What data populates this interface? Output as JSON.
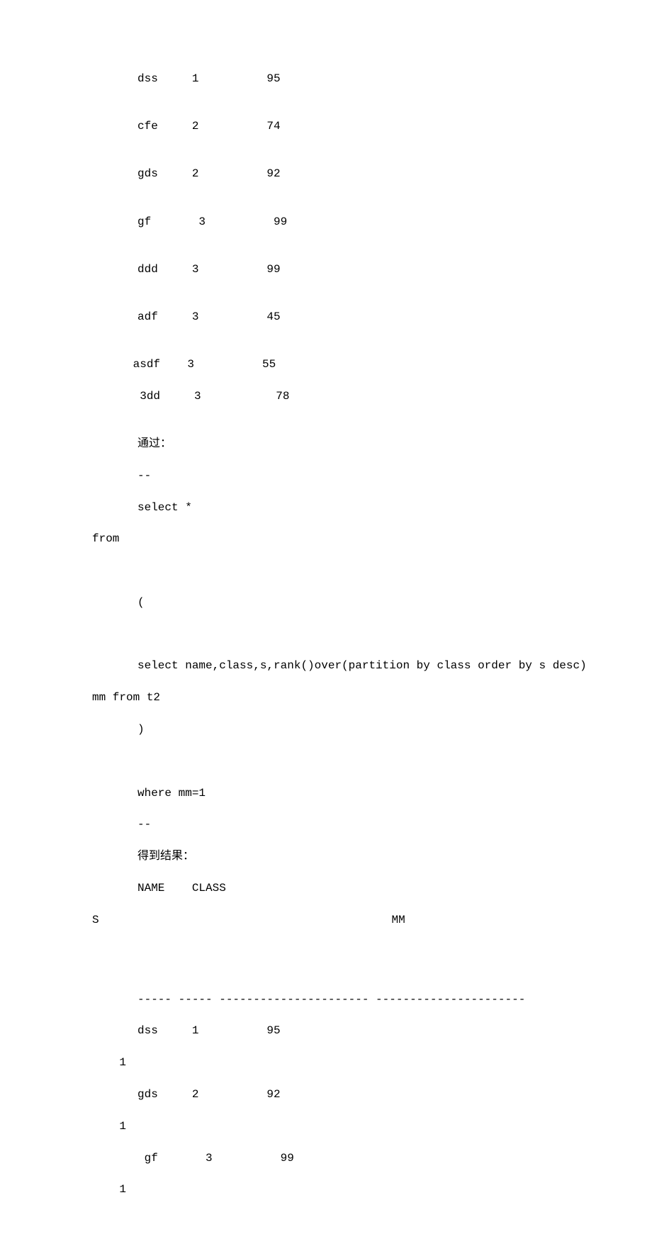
{
  "rows_top": [
    {
      "name": "dss",
      "cls": "1",
      "s": "95",
      "indent": 0
    },
    {
      "name": "cfe",
      "cls": "2",
      "s": "74",
      "indent": 0
    },
    {
      "name": "gds",
      "cls": "2",
      "s": "92",
      "indent": 0
    },
    {
      "name": "gf",
      "cls": "3",
      "s": "99",
      "indent": 0
    },
    {
      "name": "ddd",
      "cls": "3",
      "s": "99",
      "indent": 0
    },
    {
      "name": "adf",
      "cls": "3",
      "s": "45",
      "indent": 0
    }
  ],
  "rows_compact": [
    {
      "line": "asdf    3          55"
    },
    {
      "line": " 3dd     3           78"
    }
  ],
  "text_pass": "通过：",
  "text_dashes": "--",
  "text_select": "select *",
  "text_from": "from",
  "text_paren_open": "(",
  "text_select_sub": "select name,class,s,rank()over(partition by class order by s desc)",
  "text_mm_from": "mm from t2",
  "text_paren_close": ")",
  "text_where": "where mm=1",
  "text_dashes2": "--",
  "text_result_label": "得到结果：",
  "text_header1a": "NAME",
  "text_header1b": "CLASS",
  "text_header2a": "S",
  "text_header2b": "MM",
  "text_divider": "----- ----- ---------------------- ----------------------",
  "result_rows": [
    {
      "name": "dss",
      "cls": "1",
      "s": "95",
      "mm": "1"
    },
    {
      "name": "gds",
      "cls": "2",
      "s": "92",
      "mm": "1"
    },
    {
      "name": "gf",
      "cls": "3",
      "s": "99",
      "mm": "1"
    }
  ]
}
